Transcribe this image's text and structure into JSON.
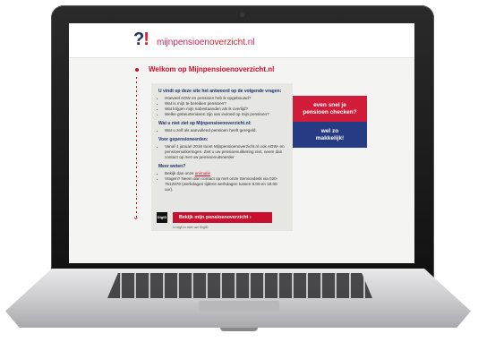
{
  "logo": {
    "mark_q": "?",
    "mark_e": "!",
    "text_a": "mijnpensioen",
    "text_b": "overzicht",
    "text_c": ".nl"
  },
  "page_title": "Welkom op Mijnpensioenoverzicht.nl",
  "info": {
    "intro_heading": "U vindt op deze site het antwoord op de volgende vragen:",
    "intro_items": [
      "Hoeveel AOW en pensioen heb ik opgebouwd?",
      "Wat is mijn te bereiken pensioen?",
      "Wat krijgen mijn nabestaanden als ik overlijd?",
      "Welke gebeurtenissen zijn van invloed op mijn pensioen?"
    ],
    "not_heading": "Wat u niet ziet op Mijnpensioenoverzicht.nl:",
    "not_items": [
      "Wat u zelf als aanvullend pensioen heeft geregeld."
    ],
    "retiree_heading": "Voor gepensioneerden:",
    "retiree_items": [
      "Vanaf 1 januari 2016 toont Mijnpensioenoverzicht.nl ook AOW- en pensioenuitkeringen. Ziet u uw pensioenuitkering niet, neem dan contact op met uw pensioenuitvoerder"
    ],
    "more_heading": "Meer weten?",
    "more_item_1_pre": "Bekijk dan onze ",
    "more_item_1_link": "animatie",
    "more_item_2": "Vragen? Neem dan contact op met onze Servicedesk via 020-7512870 (werkdagen tijdens werkdagen tussen 8.00 en 18.00 uur)."
  },
  "promo": {
    "top_line1": "even snel je",
    "top_line2": "pensioen checken?",
    "bottom_line1": "wel zo",
    "bottom_line2": "makkelijk!"
  },
  "digid_label": "DigiD",
  "cta_label": "Bekijk mijn pensioenoverzicht  ›",
  "login_note": "U logt in met uw DigiD",
  "colors": {
    "accent_red": "#c8102e",
    "navy": "#1e2f6b",
    "promo_blue": "#253b83"
  }
}
